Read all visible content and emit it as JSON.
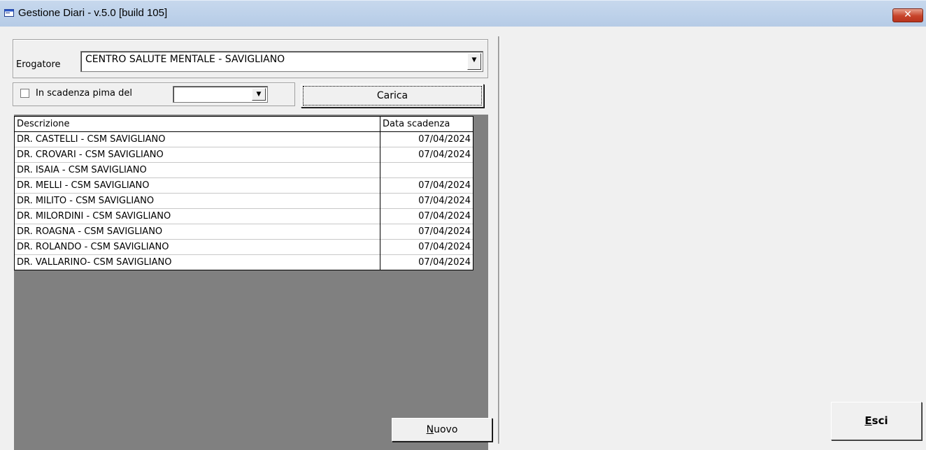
{
  "window": {
    "title": "Gestione Diari - v.5.0 [build 105]",
    "close_label": "✕"
  },
  "filters": {
    "erogatore_label": "Erogatore",
    "erogatore_value": "CENTRO SALUTE MENTALE - SAVIGLIANO",
    "scadenza_label": "In scadenza pima del",
    "scadenza_checked": false,
    "scadenza_value": "",
    "carica_label": "Carica"
  },
  "grid": {
    "columns": [
      "Descrizione",
      "Data scadenza"
    ],
    "rows": [
      {
        "descrizione": "DR. CASTELLI - CSM SAVIGLIANO",
        "data": "07/04/2024"
      },
      {
        "descrizione": "DR. CROVARI - CSM SAVIGLIANO",
        "data": "07/04/2024"
      },
      {
        "descrizione": "DR. ISAIA - CSM SAVIGLIANO",
        "data": ""
      },
      {
        "descrizione": "DR. MELLI - CSM SAVIGLIANO",
        "data": "07/04/2024"
      },
      {
        "descrizione": "DR. MILITO - CSM SAVIGLIANO",
        "data": "07/04/2024"
      },
      {
        "descrizione": "DR. MILORDINI - CSM SAVIGLIANO",
        "data": "07/04/2024"
      },
      {
        "descrizione": "DR. ROAGNA - CSM SAVIGLIANO",
        "data": "07/04/2024"
      },
      {
        "descrizione": "DR. ROLANDO - CSM SAVIGLIANO",
        "data": "07/04/2024"
      },
      {
        "descrizione": "DR. VALLARINO- CSM SAVIGLIANO",
        "data": "07/04/2024"
      }
    ]
  },
  "actions": {
    "nuovo_label_first": "N",
    "nuovo_label_rest": "uovo",
    "esci_label_first": "E",
    "esci_label_rest": "sci"
  },
  "icons": {
    "app": "window-app-icon",
    "close": "close-icon",
    "combo_arrow": "chevron-down-icon"
  }
}
